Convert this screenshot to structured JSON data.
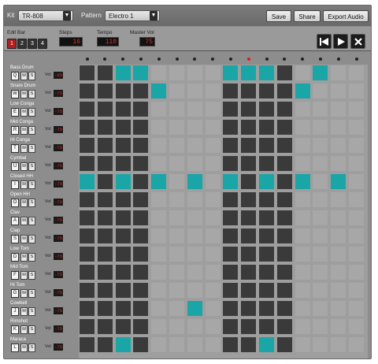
{
  "topbar": {
    "kit_label": "Kit",
    "kit_value": "TR-808",
    "pattern_label": "Pattern",
    "pattern_value": "Electro 1",
    "save_label": "Save",
    "share_label": "Share",
    "export_label": "Export Audio"
  },
  "controls": {
    "edit_bar_label": "Edit Bar",
    "bars": [
      "1",
      "2",
      "3",
      "4"
    ],
    "active_bar": 0,
    "steps_label": "Steps",
    "steps_value": "16",
    "tempo_label": "Tempo",
    "tempo_value": "110",
    "master_vol_label": "Master Vol",
    "master_vol_value": "75"
  },
  "transport": [
    "rewind-icon",
    "play-icon",
    "stop-icon"
  ],
  "step_indicator": {
    "steps": 16,
    "active_step": 9
  },
  "track_buttons": {
    "mute": "M",
    "solo": "S",
    "vol_label": "Vol"
  },
  "tracks": [
    {
      "name": "Bass Drum",
      "key": "Q",
      "vol": "-85",
      "pattern": [
        0,
        0,
        1,
        1,
        0,
        0,
        0,
        0,
        1,
        1,
        1,
        0,
        0,
        1,
        0,
        0
      ]
    },
    {
      "name": "Snare Drum",
      "key": "W",
      "vol": "-75",
      "pattern": [
        0,
        0,
        0,
        0,
        1,
        0,
        0,
        0,
        0,
        0,
        0,
        0,
        1,
        0,
        0,
        0
      ]
    },
    {
      "name": "Low Conga",
      "key": "E",
      "vol": "-75",
      "pattern": [
        0,
        0,
        0,
        0,
        0,
        0,
        0,
        0,
        0,
        0,
        0,
        0,
        0,
        0,
        0,
        0
      ]
    },
    {
      "name": "Mid Conga",
      "key": "R",
      "vol": "-75",
      "pattern": [
        0,
        0,
        0,
        0,
        0,
        0,
        0,
        0,
        0,
        0,
        0,
        0,
        0,
        0,
        0,
        0
      ]
    },
    {
      "name": "Hi Conga",
      "key": "T",
      "vol": "-75",
      "pattern": [
        0,
        0,
        0,
        0,
        0,
        0,
        0,
        0,
        0,
        0,
        0,
        0,
        0,
        0,
        0,
        0
      ]
    },
    {
      "name": "Cymbal",
      "key": "U",
      "vol": "-75",
      "pattern": [
        0,
        0,
        0,
        0,
        0,
        0,
        0,
        0,
        0,
        0,
        0,
        0,
        0,
        0,
        0,
        0
      ]
    },
    {
      "name": "Closed HH",
      "key": "I",
      "vol": "-75",
      "pattern": [
        1,
        0,
        1,
        0,
        1,
        0,
        1,
        0,
        1,
        0,
        1,
        0,
        1,
        0,
        1,
        0
      ]
    },
    {
      "name": "Open HH",
      "key": "O",
      "vol": "-75",
      "pattern": [
        0,
        0,
        0,
        0,
        0,
        0,
        0,
        0,
        0,
        0,
        0,
        0,
        0,
        0,
        0,
        0
      ]
    },
    {
      "name": "Clav",
      "key": "A",
      "vol": "-75",
      "pattern": [
        0,
        0,
        0,
        0,
        0,
        0,
        0,
        0,
        0,
        0,
        0,
        0,
        0,
        0,
        0,
        0
      ]
    },
    {
      "name": "Clap",
      "key": "S",
      "vol": "-75",
      "pattern": [
        0,
        0,
        0,
        0,
        0,
        0,
        0,
        0,
        0,
        0,
        0,
        0,
        0,
        0,
        0,
        0
      ]
    },
    {
      "name": "Low Tom",
      "key": "D",
      "vol": "-75",
      "pattern": [
        0,
        0,
        0,
        0,
        0,
        0,
        0,
        0,
        0,
        0,
        0,
        0,
        0,
        0,
        0,
        0
      ]
    },
    {
      "name": "Mid Tom",
      "key": "F",
      "vol": "-75",
      "pattern": [
        0,
        0,
        0,
        0,
        0,
        0,
        0,
        0,
        0,
        0,
        0,
        0,
        0,
        0,
        0,
        0
      ]
    },
    {
      "name": "Hi Tom",
      "key": "G",
      "vol": "-75",
      "pattern": [
        0,
        0,
        0,
        0,
        0,
        0,
        0,
        0,
        0,
        0,
        0,
        0,
        0,
        0,
        0,
        0
      ]
    },
    {
      "name": "Cowbell",
      "key": "J",
      "vol": "-75",
      "pattern": [
        0,
        0,
        0,
        0,
        0,
        0,
        1,
        0,
        0,
        0,
        0,
        0,
        0,
        0,
        0,
        0
      ]
    },
    {
      "name": "Rimshot",
      "key": "K",
      "vol": "-75",
      "pattern": [
        0,
        0,
        0,
        0,
        0,
        0,
        0,
        0,
        0,
        0,
        0,
        0,
        0,
        0,
        0,
        0
      ]
    },
    {
      "name": "Maraca",
      "key": "L",
      "vol": "-75",
      "pattern": [
        0,
        0,
        1,
        0,
        0,
        0,
        0,
        0,
        0,
        0,
        1,
        0,
        0,
        0,
        0,
        0
      ]
    }
  ],
  "colors": {
    "active": "#1aa5a7",
    "off": "#3a3a3a",
    "off_alt": "#a7a7a7",
    "lcd_text": "#e23030",
    "edit_bar_active": "#b01e1e"
  }
}
